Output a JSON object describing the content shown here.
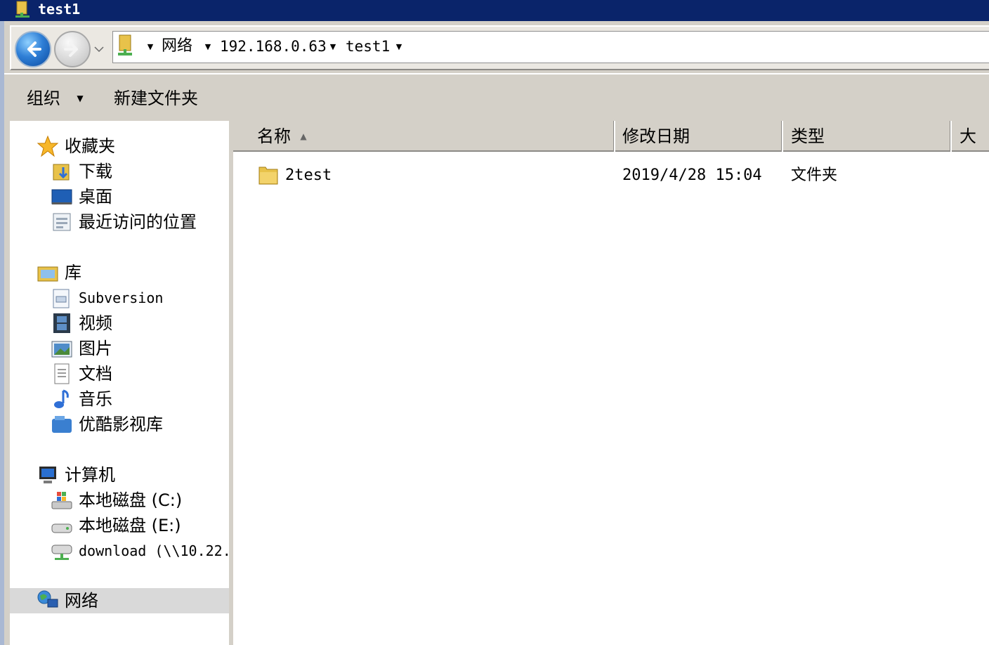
{
  "window": {
    "title": "test1"
  },
  "addressbar": {
    "crumbs": [
      "网络",
      "192.168.0.63",
      "test1"
    ]
  },
  "toolbar": {
    "organize_label": "组织",
    "new_folder_label": "新建文件夹"
  },
  "navigation": {
    "favorites": {
      "label": "收藏夹",
      "items": [
        "下载",
        "桌面",
        "最近访问的位置"
      ]
    },
    "libraries": {
      "label": "库",
      "items": [
        "Subversion",
        "视频",
        "图片",
        "文档",
        "音乐",
        "优酷影视库"
      ]
    },
    "computer": {
      "label": "计算机",
      "items": [
        "本地磁盘 (C:)",
        "本地磁盘 (E:)",
        "download (\\\\10.22."
      ]
    },
    "network": {
      "label": "网络"
    }
  },
  "filelist": {
    "columns": [
      "名称",
      "修改日期",
      "类型",
      "大小"
    ],
    "rows": [
      {
        "name": "2test",
        "modified": "2019/4/28 15:04",
        "type": "文件夹"
      }
    ]
  }
}
